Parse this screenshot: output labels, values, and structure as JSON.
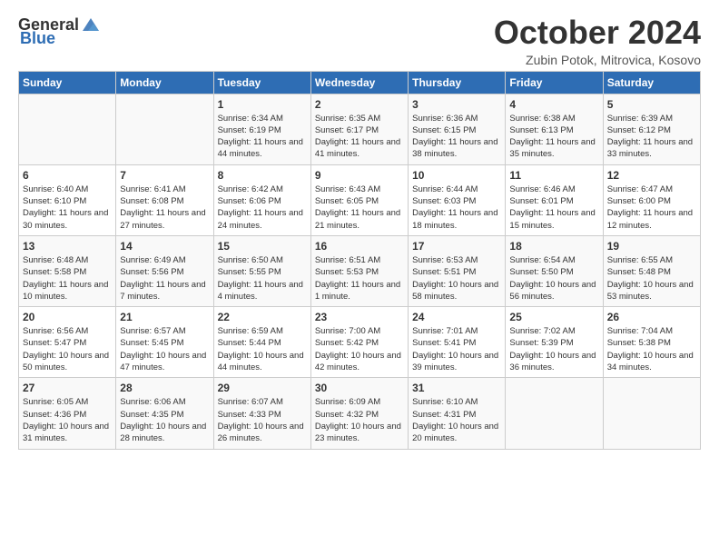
{
  "header": {
    "logo_general": "General",
    "logo_blue": "Blue",
    "title": "October 2024",
    "location": "Zubin Potok, Mitrovica, Kosovo"
  },
  "days_of_week": [
    "Sunday",
    "Monday",
    "Tuesday",
    "Wednesday",
    "Thursday",
    "Friday",
    "Saturday"
  ],
  "weeks": [
    [
      {
        "day": "",
        "info": ""
      },
      {
        "day": "",
        "info": ""
      },
      {
        "day": "1",
        "info": "Sunrise: 6:34 AM\nSunset: 6:19 PM\nDaylight: 11 hours and 44 minutes."
      },
      {
        "day": "2",
        "info": "Sunrise: 6:35 AM\nSunset: 6:17 PM\nDaylight: 11 hours and 41 minutes."
      },
      {
        "day": "3",
        "info": "Sunrise: 6:36 AM\nSunset: 6:15 PM\nDaylight: 11 hours and 38 minutes."
      },
      {
        "day": "4",
        "info": "Sunrise: 6:38 AM\nSunset: 6:13 PM\nDaylight: 11 hours and 35 minutes."
      },
      {
        "day": "5",
        "info": "Sunrise: 6:39 AM\nSunset: 6:12 PM\nDaylight: 11 hours and 33 minutes."
      }
    ],
    [
      {
        "day": "6",
        "info": "Sunrise: 6:40 AM\nSunset: 6:10 PM\nDaylight: 11 hours and 30 minutes."
      },
      {
        "day": "7",
        "info": "Sunrise: 6:41 AM\nSunset: 6:08 PM\nDaylight: 11 hours and 27 minutes."
      },
      {
        "day": "8",
        "info": "Sunrise: 6:42 AM\nSunset: 6:06 PM\nDaylight: 11 hours and 24 minutes."
      },
      {
        "day": "9",
        "info": "Sunrise: 6:43 AM\nSunset: 6:05 PM\nDaylight: 11 hours and 21 minutes."
      },
      {
        "day": "10",
        "info": "Sunrise: 6:44 AM\nSunset: 6:03 PM\nDaylight: 11 hours and 18 minutes."
      },
      {
        "day": "11",
        "info": "Sunrise: 6:46 AM\nSunset: 6:01 PM\nDaylight: 11 hours and 15 minutes."
      },
      {
        "day": "12",
        "info": "Sunrise: 6:47 AM\nSunset: 6:00 PM\nDaylight: 11 hours and 12 minutes."
      }
    ],
    [
      {
        "day": "13",
        "info": "Sunrise: 6:48 AM\nSunset: 5:58 PM\nDaylight: 11 hours and 10 minutes."
      },
      {
        "day": "14",
        "info": "Sunrise: 6:49 AM\nSunset: 5:56 PM\nDaylight: 11 hours and 7 minutes."
      },
      {
        "day": "15",
        "info": "Sunrise: 6:50 AM\nSunset: 5:55 PM\nDaylight: 11 hours and 4 minutes."
      },
      {
        "day": "16",
        "info": "Sunrise: 6:51 AM\nSunset: 5:53 PM\nDaylight: 11 hours and 1 minute."
      },
      {
        "day": "17",
        "info": "Sunrise: 6:53 AM\nSunset: 5:51 PM\nDaylight: 10 hours and 58 minutes."
      },
      {
        "day": "18",
        "info": "Sunrise: 6:54 AM\nSunset: 5:50 PM\nDaylight: 10 hours and 56 minutes."
      },
      {
        "day": "19",
        "info": "Sunrise: 6:55 AM\nSunset: 5:48 PM\nDaylight: 10 hours and 53 minutes."
      }
    ],
    [
      {
        "day": "20",
        "info": "Sunrise: 6:56 AM\nSunset: 5:47 PM\nDaylight: 10 hours and 50 minutes."
      },
      {
        "day": "21",
        "info": "Sunrise: 6:57 AM\nSunset: 5:45 PM\nDaylight: 10 hours and 47 minutes."
      },
      {
        "day": "22",
        "info": "Sunrise: 6:59 AM\nSunset: 5:44 PM\nDaylight: 10 hours and 44 minutes."
      },
      {
        "day": "23",
        "info": "Sunrise: 7:00 AM\nSunset: 5:42 PM\nDaylight: 10 hours and 42 minutes."
      },
      {
        "day": "24",
        "info": "Sunrise: 7:01 AM\nSunset: 5:41 PM\nDaylight: 10 hours and 39 minutes."
      },
      {
        "day": "25",
        "info": "Sunrise: 7:02 AM\nSunset: 5:39 PM\nDaylight: 10 hours and 36 minutes."
      },
      {
        "day": "26",
        "info": "Sunrise: 7:04 AM\nSunset: 5:38 PM\nDaylight: 10 hours and 34 minutes."
      }
    ],
    [
      {
        "day": "27",
        "info": "Sunrise: 6:05 AM\nSunset: 4:36 PM\nDaylight: 10 hours and 31 minutes."
      },
      {
        "day": "28",
        "info": "Sunrise: 6:06 AM\nSunset: 4:35 PM\nDaylight: 10 hours and 28 minutes."
      },
      {
        "day": "29",
        "info": "Sunrise: 6:07 AM\nSunset: 4:33 PM\nDaylight: 10 hours and 26 minutes."
      },
      {
        "day": "30",
        "info": "Sunrise: 6:09 AM\nSunset: 4:32 PM\nDaylight: 10 hours and 23 minutes."
      },
      {
        "day": "31",
        "info": "Sunrise: 6:10 AM\nSunset: 4:31 PM\nDaylight: 10 hours and 20 minutes."
      },
      {
        "day": "",
        "info": ""
      },
      {
        "day": "",
        "info": ""
      }
    ]
  ]
}
